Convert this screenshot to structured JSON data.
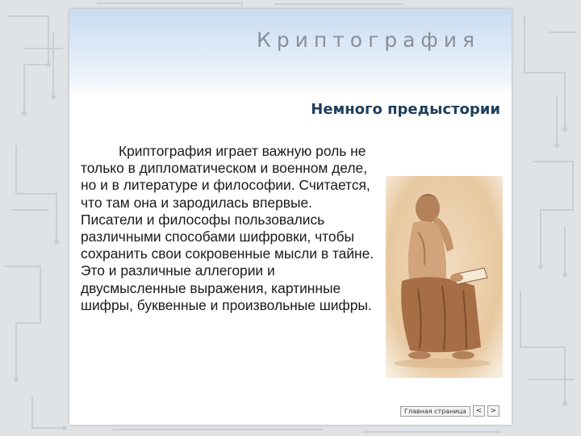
{
  "header": {
    "title": "Криптография"
  },
  "slide": {
    "heading": "Немного предыстории",
    "paragraph": "Криптография играет важную роль не только в дипломатическом и военном деле, но и в литературе и философии. Считается, что там она и зародилась впервые. Писатели и философы пользовались различными способами шифровки, чтобы сохранить свои сокровенные мысли в тайне. Это и различные аллегории и двусмысленные выражения, картинные шифры, буквенные и произвольные шифры."
  },
  "navigation": {
    "home_label": "Главная страница",
    "prev_label": "<",
    "next_label": ">"
  },
  "colors": {
    "heading": "#1d3f5c",
    "header_gradient_top": "#c8dcf2",
    "background": "#dfe3e6"
  },
  "illustration": {
    "icon": "thinking-philosopher-figure"
  }
}
